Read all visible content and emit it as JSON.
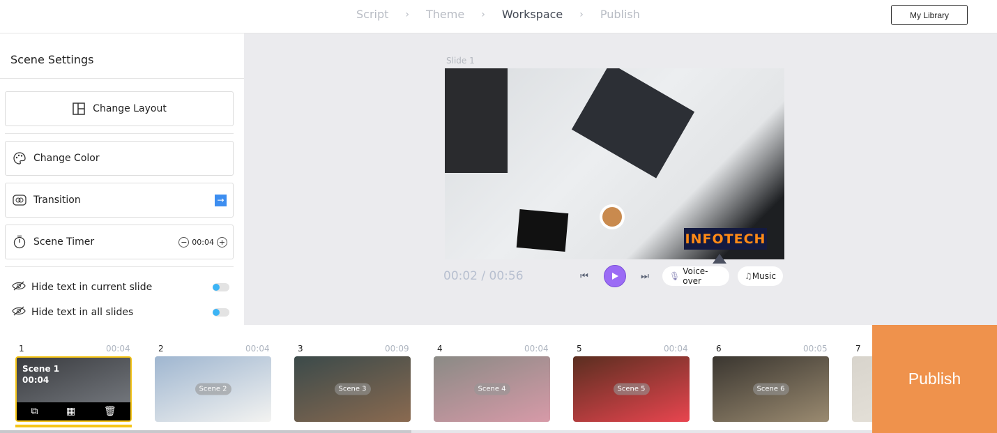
{
  "steps": [
    "Script",
    "Theme",
    "Workspace",
    "Publish"
  ],
  "active_step": "Workspace",
  "my_library": "My Library",
  "panel": {
    "title": "Scene Settings",
    "change_layout": "Change Layout",
    "change_color": "Change Color",
    "transition": "Transition",
    "scene_timer": "Scene Timer",
    "timer_value": "00:04",
    "hide_current": "Hide text in current slide",
    "hide_all": "Hide text in all slides"
  },
  "preview": {
    "slide_label": "Slide 1",
    "brand_text": "INFOTECH",
    "time": "00:02 / 00:56",
    "voice_over": "Voice-over",
    "music": "Music"
  },
  "scenes": [
    {
      "num": "1",
      "dur": "00:04",
      "label": "Scene 1",
      "colors": [
        "#3a3c40",
        "#7d8187"
      ]
    },
    {
      "num": "2",
      "dur": "00:04",
      "label": "Scene 2",
      "colors": [
        "#9fb6d0",
        "#f3f3f1"
      ]
    },
    {
      "num": "3",
      "dur": "00:09",
      "label": "Scene 3",
      "colors": [
        "#3b4a4a",
        "#8a6a50"
      ]
    },
    {
      "num": "4",
      "dur": "00:04",
      "label": "Scene 4",
      "colors": [
        "#8a8a85",
        "#d79aa8"
      ]
    },
    {
      "num": "5",
      "dur": "00:04",
      "label": "Scene 5",
      "colors": [
        "#5a2e20",
        "#e8454f"
      ]
    },
    {
      "num": "6",
      "dur": "00:05",
      "label": "Scene 6",
      "colors": [
        "#3a3630",
        "#9a8a70"
      ]
    },
    {
      "num": "7",
      "dur": "",
      "label": "",
      "colors": [
        "#d8d4cc",
        "#e8e4dc"
      ]
    }
  ],
  "selected_scene_time": "00:04",
  "publish": "Publish",
  "colors": {
    "accent_play": "#9b6bf5",
    "publish": "#ef924c",
    "selected": "#f5c518",
    "brand_bg": "#141a40",
    "brand_text": "#ff8a16"
  }
}
